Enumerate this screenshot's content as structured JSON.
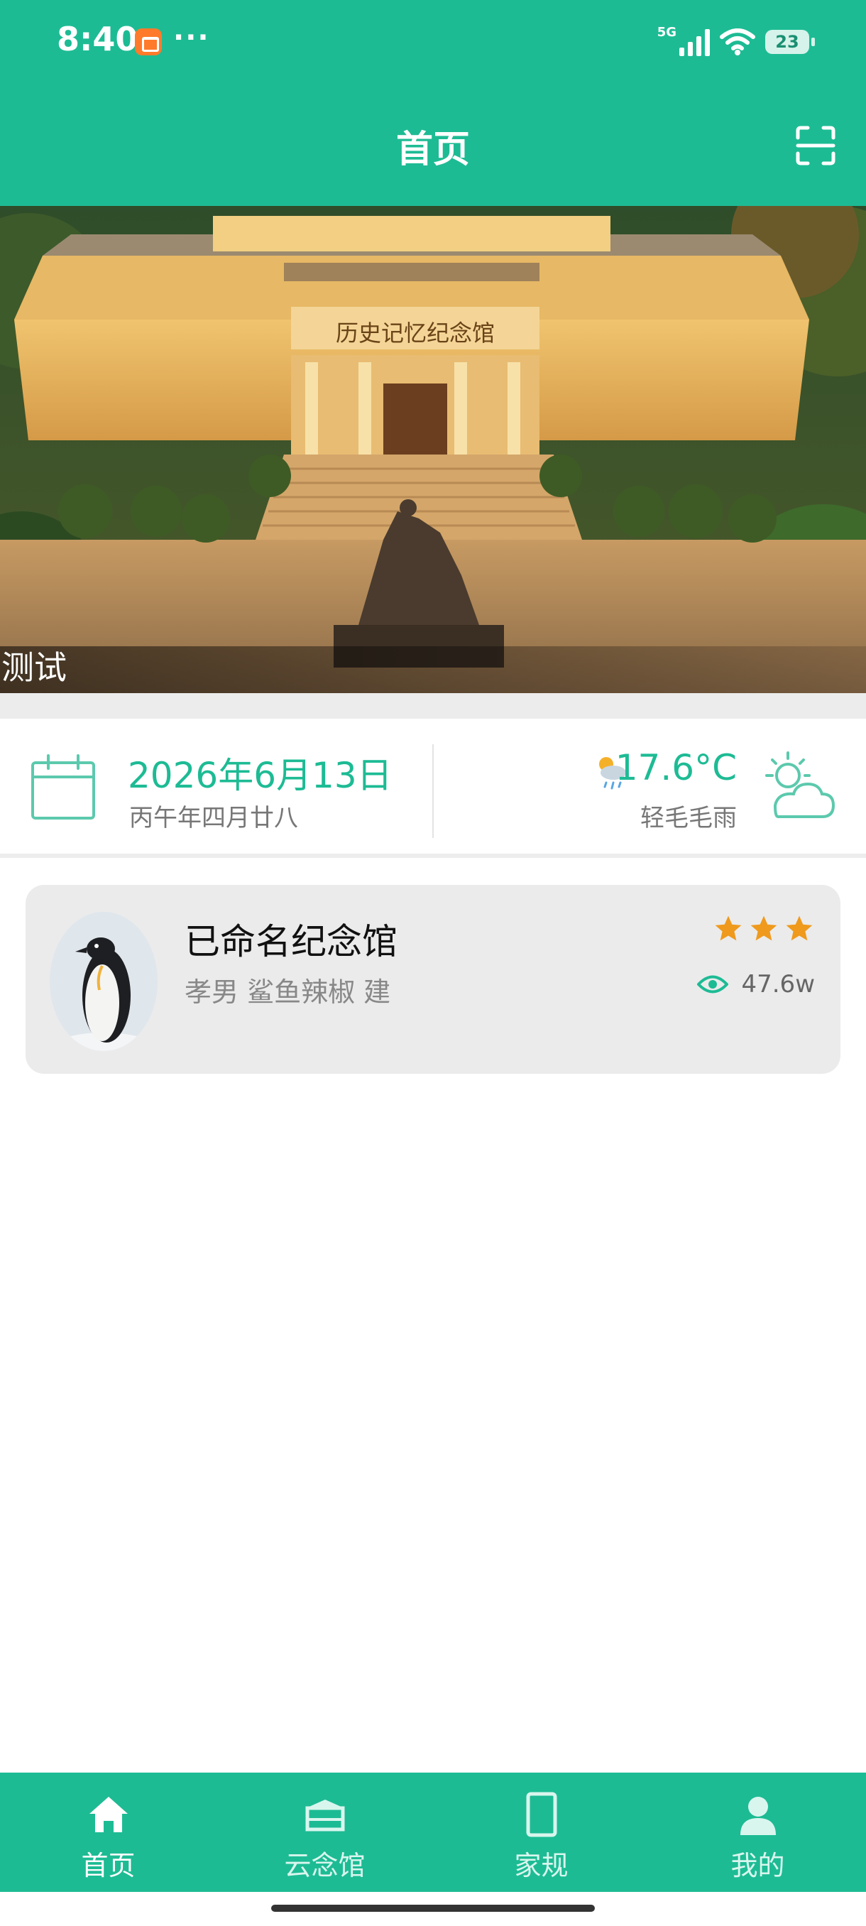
{
  "status_bar": {
    "time": "8:40",
    "dots": "···",
    "network": "5G",
    "battery": "23"
  },
  "header": {
    "title": "首页"
  },
  "banner": {
    "caption": "测试",
    "building_sign": "历史记忆纪念馆"
  },
  "date_weather": {
    "date": "2026年6月13日",
    "lunar": "丙午年四月廿八",
    "temperature": "17.6°C",
    "weather": "轻毛毛雨"
  },
  "memorial_card": {
    "name": "已命名纪念馆",
    "description": "孝男 鲨鱼辣椒 建",
    "rating": 3,
    "views": "47.6w"
  },
  "tabs": [
    {
      "label": "首页",
      "icon": "home-icon",
      "active": true
    },
    {
      "label": "云念馆",
      "icon": "hall-icon",
      "active": false
    },
    {
      "label": "家规",
      "icon": "book-icon",
      "active": false
    },
    {
      "label": "我的",
      "icon": "person-icon",
      "active": false
    }
  ],
  "colors": {
    "brand": "#1dbb94",
    "star": "#ef9a1d"
  }
}
